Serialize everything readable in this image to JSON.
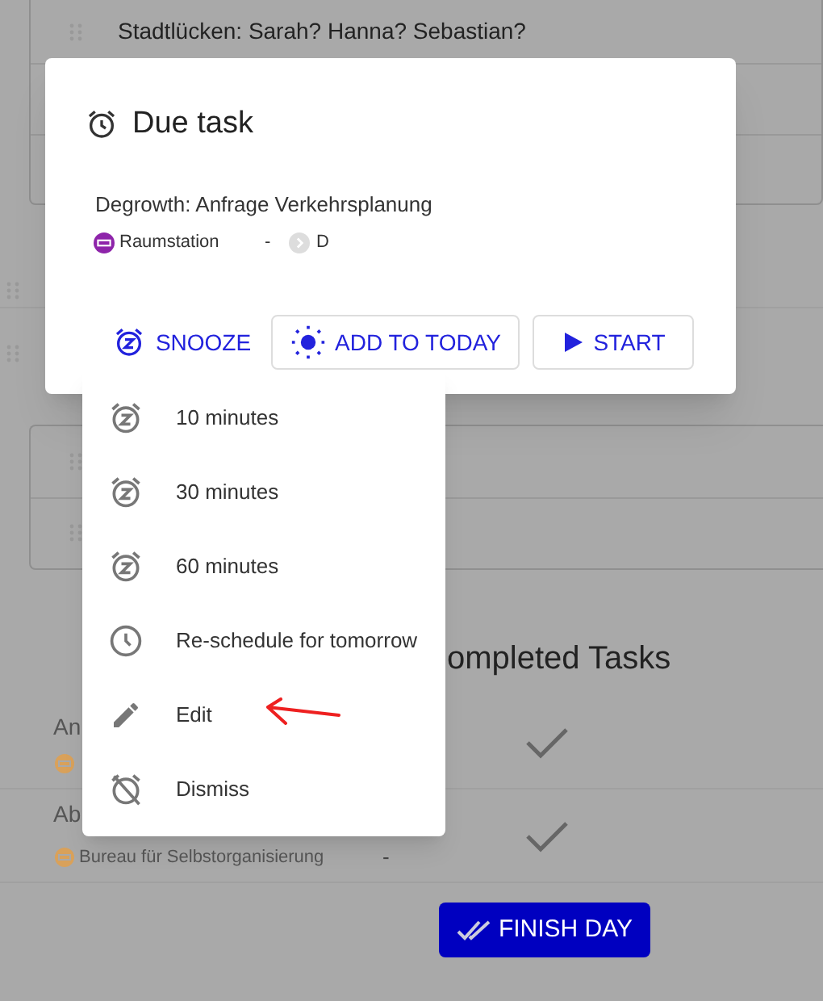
{
  "background": {
    "task_list": [
      {
        "title": "Stadtlücken: Sarah? Hanna? Sebastian?"
      }
    ],
    "completed_heading": "ompleted Tasks",
    "completed_tasks": [
      {
        "title": "An"
      },
      {
        "title": "Ab",
        "tag": "Bureau für Selbstorganisierung",
        "separator": "-"
      }
    ],
    "finish_button": "FINISH DAY"
  },
  "dialog": {
    "title": "Due task",
    "task": "Degrowth: Anfrage Verkehrsplanung",
    "project": "Raumstation",
    "separator": "-",
    "section": "D",
    "buttons": [
      {
        "label": "SNOOZE",
        "kind": "snooze"
      },
      {
        "label": "ADD TO TODAY",
        "kind": "today"
      },
      {
        "label": "START",
        "kind": "start"
      }
    ]
  },
  "snooze_menu": [
    {
      "label": "10 minutes",
      "kind": "snooze"
    },
    {
      "label": "30 minutes",
      "kind": "snooze"
    },
    {
      "label": "60 minutes",
      "kind": "snooze"
    },
    {
      "label": "Re-schedule for tomorrow",
      "kind": "clock"
    },
    {
      "label": "Edit",
      "kind": "edit"
    },
    {
      "label": "Dismiss",
      "kind": "dismiss"
    }
  ]
}
